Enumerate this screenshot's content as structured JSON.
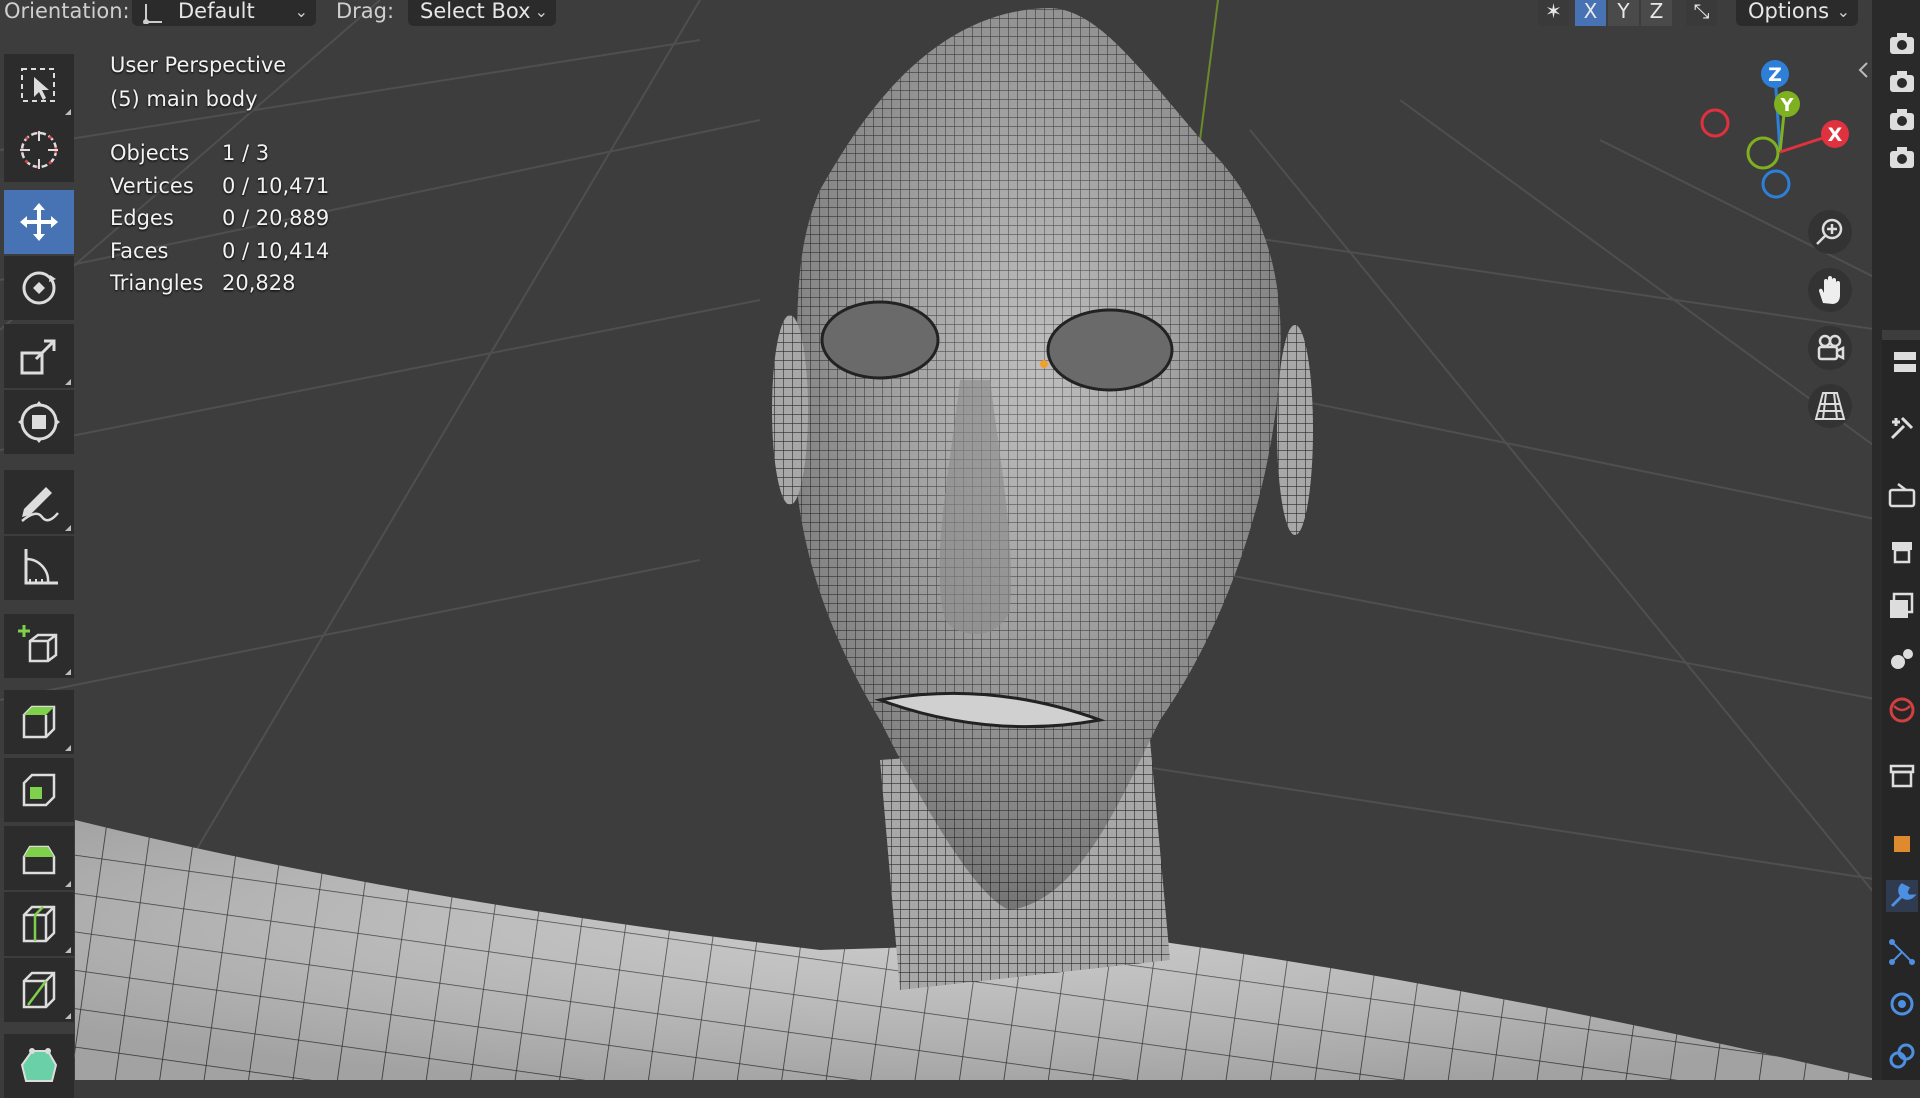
{
  "header": {
    "orientation_label": "Orientation:",
    "orientation_value": "Default",
    "drag_label": "Drag:",
    "drag_value": "Select Box",
    "axis_x": "X",
    "axis_y": "Y",
    "axis_z": "Z",
    "options_label": "Options"
  },
  "overlay": {
    "view_name": "User Perspective",
    "object_name": "(5) main body"
  },
  "stats": [
    {
      "label": "Objects",
      "value": "1 / 3"
    },
    {
      "label": "Vertices",
      "value": "0 / 10,471"
    },
    {
      "label": "Edges",
      "value": "0 / 20,889"
    },
    {
      "label": "Faces",
      "value": "0 / 10,414"
    },
    {
      "label": "Triangles",
      "value": "20,828"
    }
  ],
  "gizmo": {
    "z": "Z",
    "y": "Y",
    "x": "X"
  },
  "toolbar": {
    "items": [
      {
        "icon": "select-box-icon",
        "active": false
      },
      {
        "icon": "cursor-icon",
        "active": false
      },
      {
        "icon": "move-icon",
        "active": true
      },
      {
        "icon": "rotate-icon",
        "active": false
      },
      {
        "icon": "scale-icon",
        "active": false
      },
      {
        "icon": "transform-icon",
        "active": false
      },
      {
        "icon": "annotate-icon",
        "active": false
      },
      {
        "icon": "measure-icon",
        "active": false
      },
      {
        "icon": "add-cube-icon",
        "active": false
      },
      {
        "icon": "extrude-icon",
        "active": false
      },
      {
        "icon": "inset-icon",
        "active": false
      },
      {
        "icon": "bevel-icon",
        "active": false
      },
      {
        "icon": "loop-cut-icon",
        "active": false
      },
      {
        "icon": "knife-icon",
        "active": false
      },
      {
        "icon": "poly-build-icon",
        "active": false
      }
    ]
  },
  "colors": {
    "active": "#4772b3",
    "axis_x": "#e0313f",
    "axis_y": "#7fb020",
    "axis_z": "#2d7fd8"
  }
}
